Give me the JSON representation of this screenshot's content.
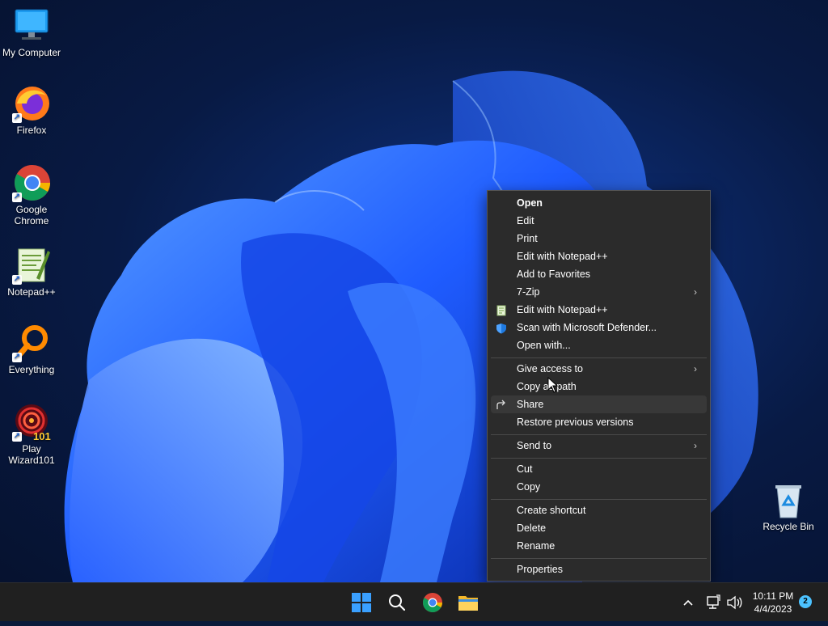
{
  "desktop": {
    "icons": [
      {
        "label": "My Computer",
        "icon": "monitor-icon"
      },
      {
        "label": "Firefox",
        "icon": "firefox-icon"
      },
      {
        "label": "Google Chrome",
        "icon": "chrome-icon"
      },
      {
        "label": "Notepad++",
        "icon": "notepadpp-icon"
      },
      {
        "label": "Everything",
        "icon": "everything-icon"
      },
      {
        "label": "Play Wizard101",
        "icon": "wizard101-icon"
      },
      {
        "label": "Recycle Bin",
        "icon": "recycle-bin-icon"
      }
    ]
  },
  "context_menu": {
    "groups": [
      [
        "Open",
        "Edit",
        "Print",
        "Edit with Notepad++",
        "Add to Favorites",
        "7-Zip",
        "Edit with Notepad++",
        "Scan with Microsoft Defender...",
        "Open with..."
      ],
      [
        "Give access to",
        "Copy as path",
        "Share",
        "Restore previous versions"
      ],
      [
        "Send to"
      ],
      [
        "Cut",
        "Copy"
      ],
      [
        "Create shortcut",
        "Delete",
        "Rename"
      ],
      [
        "Properties"
      ]
    ],
    "items": {
      "open": "Open",
      "edit": "Edit",
      "print": "Print",
      "edit_notepadpp": "Edit with Notepad++",
      "add_favorites": "Add to Favorites",
      "sevenzip": "7-Zip",
      "edit_notepadpp_2": "Edit with Notepad++",
      "scan_defender": "Scan with Microsoft Defender...",
      "open_with": "Open with...",
      "give_access": "Give access to",
      "copy_as_path": "Copy as path",
      "share": "Share",
      "restore_versions": "Restore previous versions",
      "send_to": "Send to",
      "cut": "Cut",
      "copy": "Copy",
      "create_shortcut": "Create shortcut",
      "delete": "Delete",
      "rename": "Rename",
      "properties": "Properties"
    },
    "hovered": "Share"
  },
  "taskbar": {
    "pinned": [
      "start-icon",
      "search-icon",
      "chrome-icon",
      "file-explorer-icon"
    ],
    "tray_icons": [
      "chevron-up-icon",
      "network-icon",
      "volume-icon"
    ],
    "time": "10:11 PM",
    "date": "4/4/2023",
    "notification_count": "2"
  },
  "colors": {
    "menu_bg": "#2b2b2b",
    "taskbar_bg": "#202020",
    "accent": "#4cc2ff",
    "wallpaper_blue": "#1e5bff"
  }
}
